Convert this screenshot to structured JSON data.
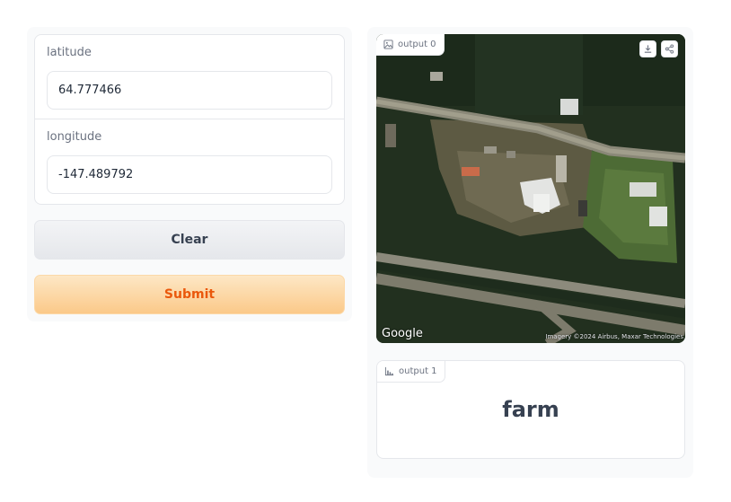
{
  "inputs": {
    "latitude": {
      "label": "latitude",
      "value": "64.777466"
    },
    "longitude": {
      "label": "longitude",
      "value": "-147.489792"
    }
  },
  "buttons": {
    "clear_label": "Clear",
    "submit_label": "Submit"
  },
  "outputs": {
    "image": {
      "label": "output 0",
      "icon": "image-icon",
      "actions": [
        "download-icon",
        "share-icon"
      ],
      "watermark": "Google",
      "attribution": "Imagery ©2024 Airbus, Maxar Technologies"
    },
    "classification": {
      "label": "output 1",
      "icon": "bar-chart-icon",
      "prediction": "farm"
    }
  },
  "colors": {
    "accent": "#ea580c",
    "submit_bg": "#fbc989",
    "border": "#e5e7eb",
    "panel_bg": "#f9fafb"
  }
}
